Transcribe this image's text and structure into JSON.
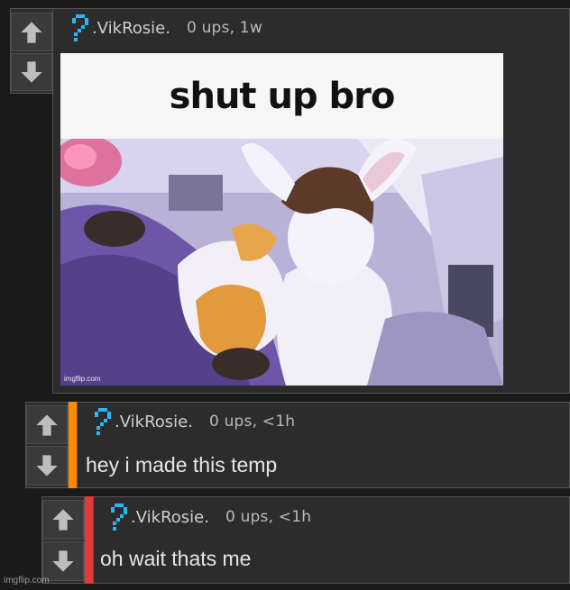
{
  "comments": [
    {
      "username": ".VikRosie.",
      "stats": "0 ups, 1w",
      "image_caption": "shut up bro",
      "image_watermark": "imgflip.com"
    },
    {
      "username": ".VikRosie.",
      "stats": "0 ups, <1h",
      "text": "hey i made this temp",
      "depth_color": "#ff8a00"
    },
    {
      "username": ".VikRosie.",
      "stats": "0 ups, <1h",
      "text": "oh wait thats me",
      "depth_color": "#e53935"
    }
  ],
  "site_watermark": "imgflip.com",
  "icons": {
    "upvote": "arrow-up-icon",
    "downvote": "arrow-down-icon",
    "user": "pixel-question-icon"
  }
}
